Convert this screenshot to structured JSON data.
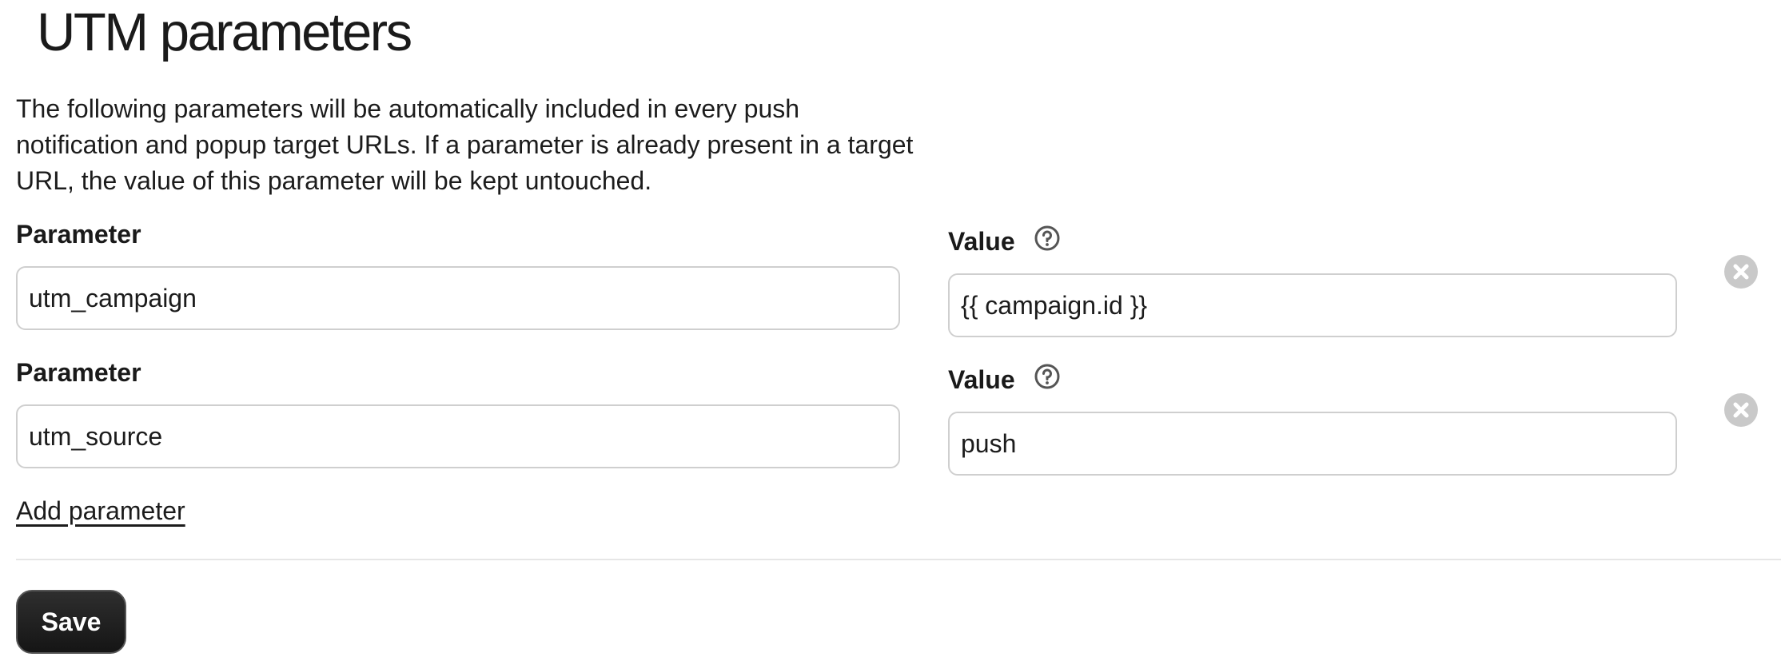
{
  "page": {
    "title": "UTM parameters",
    "description": "The following parameters will be automatically included in every push notification and popup target URLs. If a parameter is already present in a target URL, the value of this parameter will be kept untouched."
  },
  "params": [
    {
      "param_label": "Parameter",
      "param_value": "utm_campaign",
      "value_label": "Value",
      "value_value": "{{ campaign.id }}"
    },
    {
      "param_label": "Parameter",
      "param_value": "utm_source",
      "value_label": "Value",
      "value_value": "push"
    }
  ],
  "actions": {
    "add_parameter": "Add parameter",
    "save": "Save"
  },
  "icons": {
    "help": "question-circle-icon",
    "remove": "remove-x-circle-icon"
  },
  "colors": {
    "text": "#1c1c1c",
    "border": "#cfcfcf",
    "icon_gray": "#c9c9c9",
    "button_bg": "#1f1f1f"
  }
}
